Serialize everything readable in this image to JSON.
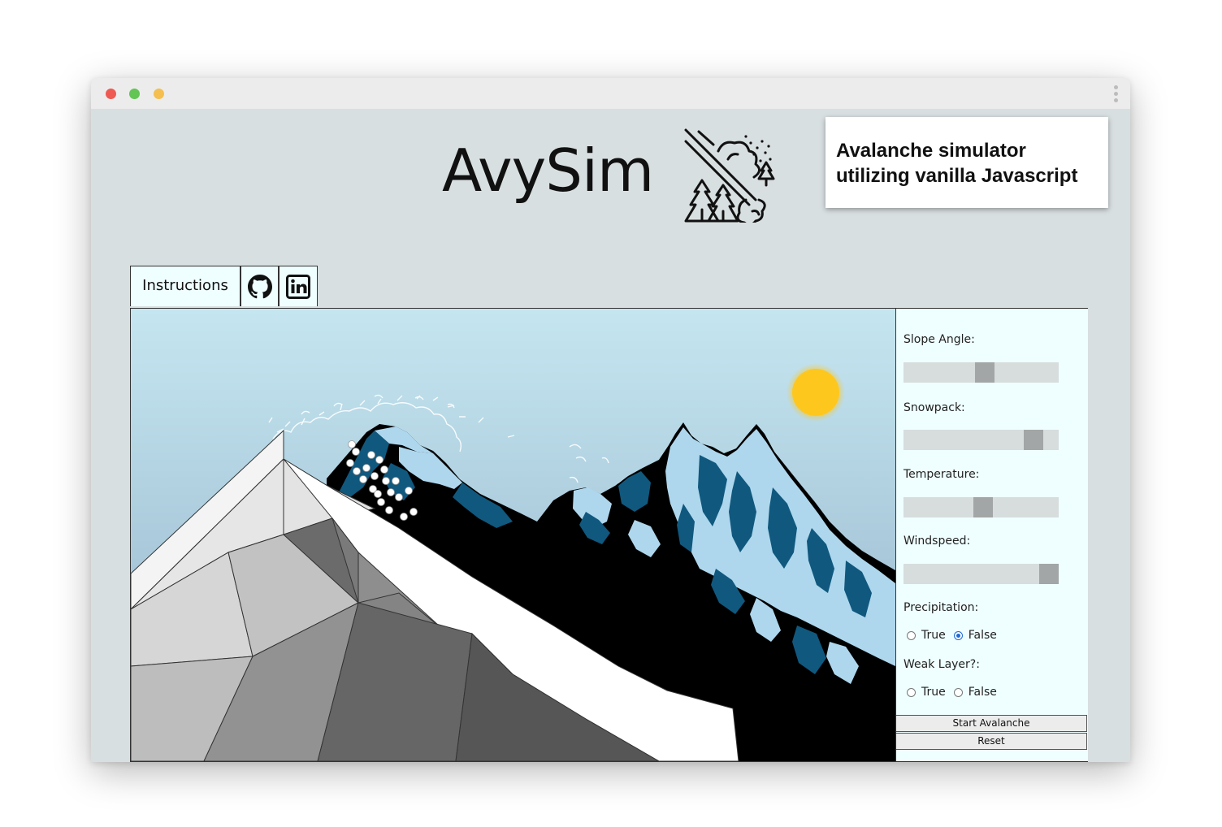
{
  "app": {
    "title": "AvySim",
    "caption_line1": "Avalanche simulator",
    "caption_line2": "utilizing vanilla Javascript"
  },
  "tabs": {
    "instructions": "Instructions",
    "github_icon": "github-icon",
    "linkedin_icon": "linkedin-icon"
  },
  "controls": {
    "slope_angle": {
      "label": "Slope Angle:",
      "value_fraction": 0.52
    },
    "snowpack": {
      "label": "Snowpack:",
      "value_fraction": 0.92
    },
    "temperature": {
      "label": "Temperature:",
      "value_fraction": 0.51
    },
    "windspeed": {
      "label": "Windspeed:",
      "value_fraction": 1.0
    },
    "precipitation": {
      "label": "Precipitation:",
      "options": [
        "True",
        "False"
      ],
      "selected": "False"
    },
    "weak_layer": {
      "label": "Weak Layer?:",
      "options": [
        "True",
        "False"
      ],
      "selected": null
    },
    "start_button": "Start Avalanche",
    "reset_button": "Reset"
  },
  "colors": {
    "sky_top": "#c5e6f0",
    "sky_bottom": "#9dbad0",
    "sun": "#fec71e",
    "mountain_blue": "#10587e",
    "snow_light": "#aed7ed"
  }
}
